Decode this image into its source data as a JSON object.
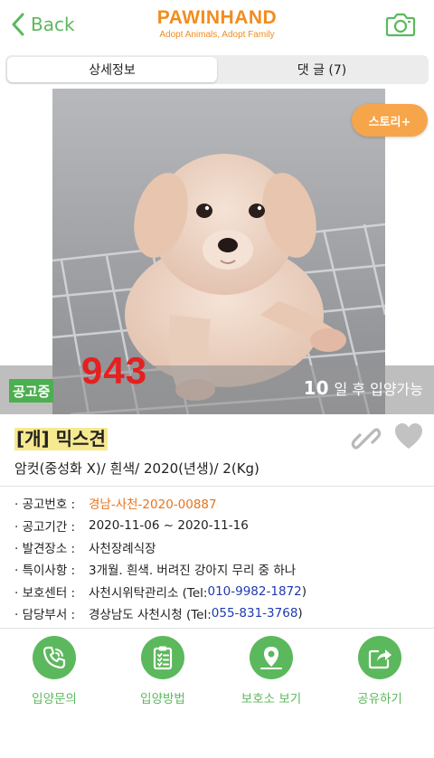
{
  "header": {
    "back_label": "Back",
    "brand_name": "PAWINHAND",
    "brand_tagline": "Adopt Animals, Adopt Family",
    "accent_color": "#5cb85c",
    "brand_color": "#f28c1e"
  },
  "tabs": [
    {
      "label": "상세정보",
      "active": true
    },
    {
      "label": "댓 글 (7)",
      "active": false
    }
  ],
  "photo": {
    "story_button": "스토리+",
    "status_badge": "공고중",
    "overlay_number": "943",
    "days_number": "10",
    "days_text": "일 후 입양가능"
  },
  "animal": {
    "title": "[개] 믹스견",
    "summary": "암컷(중성화 X)/ 흰색/ 2020(년생)/ 2(Kg)"
  },
  "info": [
    {
      "label": "· 공고번호 :",
      "value": "경남-사천-2020-00887"
    },
    {
      "label": "· 공고기간 :",
      "value": "2020-11-06 ~ 2020-11-16"
    },
    {
      "label": "· 발견장소 :",
      "value": "사천장례식장"
    },
    {
      "label": "· 특이사항 :",
      "value": "3개월. 흰색. 버려진 강아지 무리 중 하나"
    },
    {
      "label": "· 보호센터 :",
      "value": "사천시위탁관리소 (Tel: ",
      "tel": "010-9982-1872",
      "suffix": ")"
    },
    {
      "label": "· 담당부서 :",
      "value": "경상남도 사천시청 (Tel: ",
      "tel": "055-831-3768",
      "suffix": ")"
    }
  ],
  "actions": [
    {
      "label": "입양문의",
      "icon": "phone-icon"
    },
    {
      "label": "입양방법",
      "icon": "clipboard-icon"
    },
    {
      "label": "보호소 보기",
      "icon": "map-pin-icon"
    },
    {
      "label": "공유하기",
      "icon": "share-icon"
    }
  ]
}
